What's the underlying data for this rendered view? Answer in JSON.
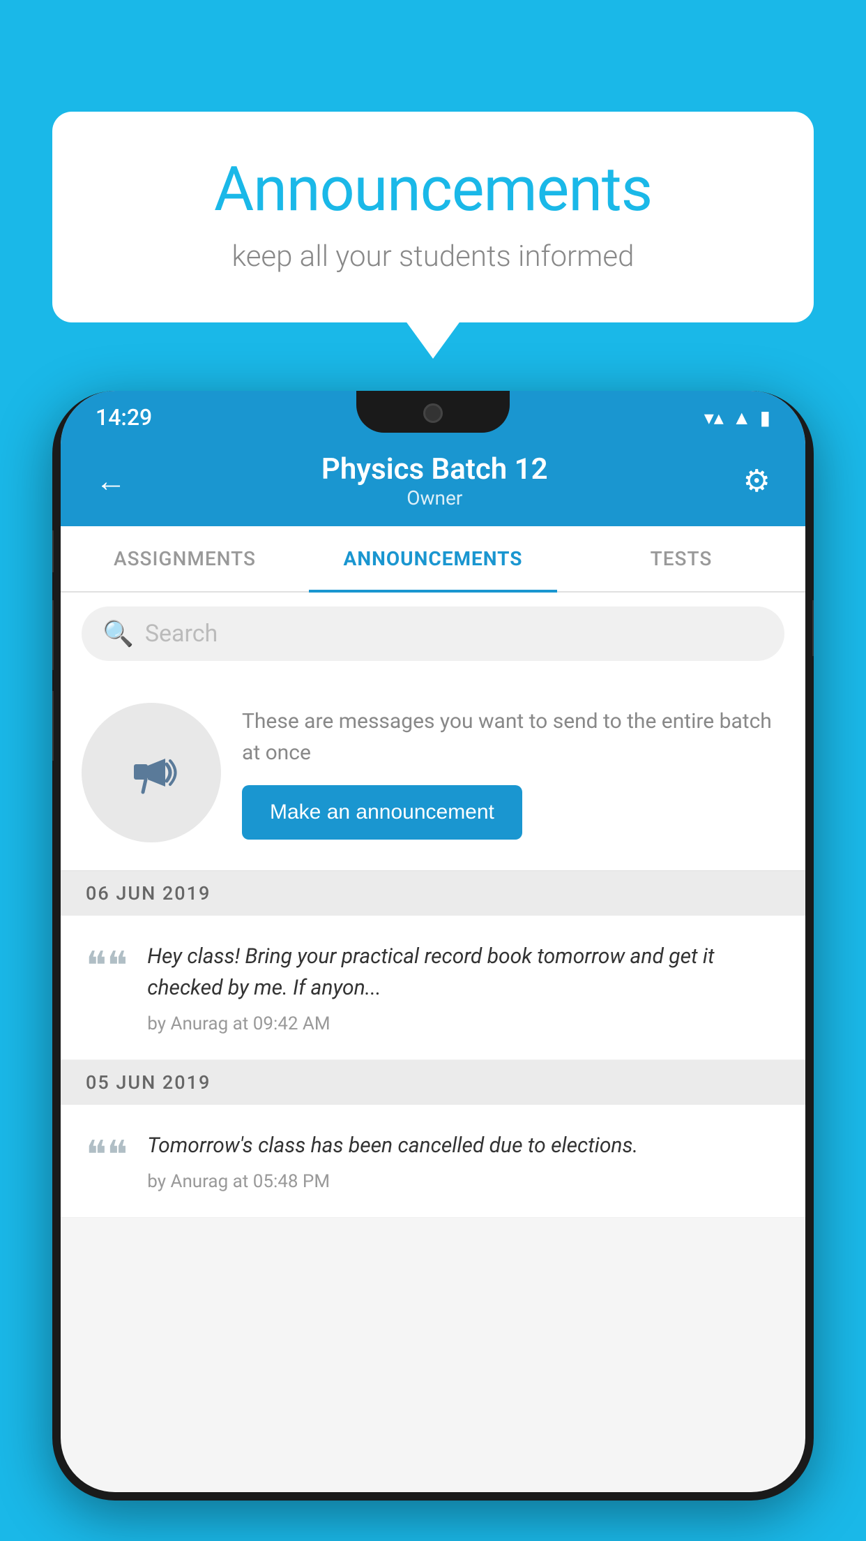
{
  "background_color": "#1ab8e8",
  "speech_bubble": {
    "title": "Announcements",
    "subtitle": "keep all your students informed"
  },
  "phone": {
    "status_bar": {
      "time": "14:29",
      "icons": [
        "wifi",
        "signal",
        "battery"
      ]
    },
    "header": {
      "title": "Physics Batch 12",
      "subtitle": "Owner",
      "back_label": "←",
      "gear_label": "⚙"
    },
    "tabs": [
      {
        "label": "ASSIGNMENTS",
        "active": false
      },
      {
        "label": "ANNOUNCEMENTS",
        "active": true
      },
      {
        "label": "TESTS",
        "active": false
      }
    ],
    "search": {
      "placeholder": "Search"
    },
    "announcement_promo": {
      "description": "These are messages you want to send to the entire batch at once",
      "button_label": "Make an announcement"
    },
    "announcements": [
      {
        "date": "06  JUN  2019",
        "items": [
          {
            "text": "Hey class! Bring your practical record book tomorrow and get it checked by me. If anyon...",
            "meta": "by Anurag at 09:42 AM"
          }
        ]
      },
      {
        "date": "05  JUN  2019",
        "items": [
          {
            "text": "Tomorrow's class has been cancelled due to elections.",
            "meta": "by Anurag at 05:48 PM"
          }
        ]
      }
    ]
  }
}
